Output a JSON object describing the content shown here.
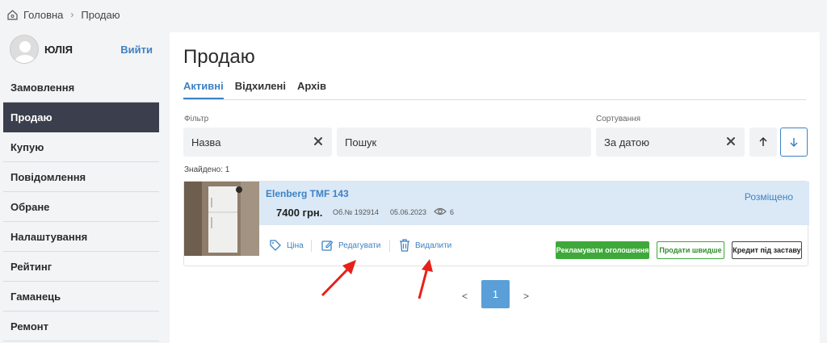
{
  "breadcrumb": {
    "home": "Головна",
    "current": "Продаю"
  },
  "user": {
    "name": "ЮЛІЯ",
    "logout": "Вийти"
  },
  "menu": [
    {
      "label": "Замовлення",
      "active": false
    },
    {
      "label": "Продаю",
      "active": true
    },
    {
      "label": "Купую",
      "active": false
    },
    {
      "label": "Повідомлення",
      "active": false
    },
    {
      "label": "Обране",
      "active": false
    },
    {
      "label": "Налаштування",
      "active": false
    },
    {
      "label": "Рейтинг",
      "active": false
    },
    {
      "label": "Гаманець",
      "active": false
    },
    {
      "label": "Ремонт",
      "active": false
    }
  ],
  "page": {
    "title": "Продаю"
  },
  "tabs": [
    {
      "label": "Активні",
      "active": true
    },
    {
      "label": "Відхилені",
      "active": false
    },
    {
      "label": "Архів",
      "active": false
    }
  ],
  "filter": {
    "label": "Фільтр",
    "name_value": "Назва",
    "search_placeholder": "Пошук"
  },
  "sort": {
    "label": "Сортування",
    "value": "За датою"
  },
  "found": "Знайдено: 1",
  "listing": {
    "title": "Elenberg TMF 143",
    "price": "7400 грн.",
    "ad_number": "Об.№ 192914",
    "date": "05.06.2023",
    "views": "6",
    "status": "Розміщено",
    "actions": {
      "price": "Ціна",
      "edit": "Редагувати",
      "delete": "Видалити"
    },
    "buttons": {
      "promote": "Рекламувати оголошення",
      "sell_faster": "Продати швидше",
      "credit": "Кредит під заставу"
    }
  },
  "pagination": {
    "prev": "<",
    "current": "1",
    "next": ">"
  },
  "colors": {
    "accent": "#3d82c4",
    "active_menu": "#3b3f4d",
    "promote": "#3ea83a",
    "annotation_arrow": "#e8201a"
  }
}
